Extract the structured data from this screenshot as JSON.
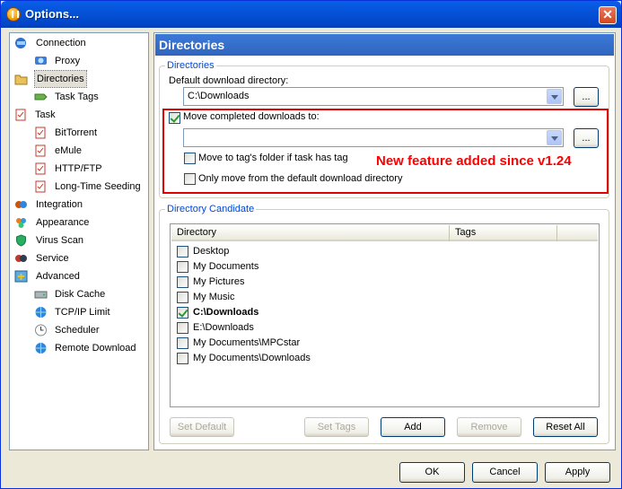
{
  "window": {
    "title": "Options...",
    "close_symbol": "✕"
  },
  "tree": {
    "items": [
      {
        "label": "Connection",
        "icon": "connection-icon"
      },
      {
        "label": "Proxy",
        "icon": "proxy-icon"
      },
      {
        "label": "Directories",
        "icon": "folder-open-icon",
        "selected": true
      },
      {
        "label": "Task Tags",
        "icon": "tag-icon"
      },
      {
        "label": "Task",
        "icon": "task-icon"
      },
      {
        "label": "BitTorrent",
        "icon": "task-icon"
      },
      {
        "label": "eMule",
        "icon": "task-icon"
      },
      {
        "label": "HTTP/FTP",
        "icon": "task-icon"
      },
      {
        "label": "Long-Time Seeding",
        "icon": "task-icon"
      },
      {
        "label": "Integration",
        "icon": "integration-icon"
      },
      {
        "label": "Appearance",
        "icon": "appearance-icon"
      },
      {
        "label": "Virus Scan",
        "icon": "shield-icon"
      },
      {
        "label": "Service",
        "icon": "service-icon"
      },
      {
        "label": "Advanced",
        "icon": "advanced-icon"
      },
      {
        "label": "Disk Cache",
        "icon": "disk-cache-icon"
      },
      {
        "label": "TCP/IP Limit",
        "icon": "globe-icon"
      },
      {
        "label": "Scheduler",
        "icon": "scheduler-icon"
      },
      {
        "label": "Remote Download",
        "icon": "globe-icon"
      }
    ]
  },
  "main": {
    "header": "Directories",
    "directories_group": {
      "title": "Directories",
      "default_dir_label": "Default download directory:",
      "default_dir_value": "C:\\Downloads",
      "browse_label": "...",
      "move_completed_label": "Move completed downloads to:",
      "move_completed_checked": true,
      "move_completed_value": "",
      "browse2_label": "...",
      "tag_folder_label": "Move to tag's folder if task has tag",
      "tag_folder_checked": false,
      "only_default_label": "Only move from the default download directory",
      "only_default_checked": false
    },
    "annotation": "New feature added since v1.24",
    "candidate_group": {
      "title": "Directory Candidate",
      "columns": [
        "Directory",
        "Tags"
      ],
      "rows": [
        {
          "dir": "Desktop",
          "checked": false
        },
        {
          "dir": "My Documents",
          "checked": false
        },
        {
          "dir": "My Pictures",
          "checked": false
        },
        {
          "dir": "My Music",
          "checked": false
        },
        {
          "dir": "C:\\Downloads",
          "checked": true
        },
        {
          "dir": "E:\\Downloads",
          "checked": false
        },
        {
          "dir": "My Documents\\MPCstar",
          "checked": false
        },
        {
          "dir": "My Documents\\Downloads",
          "checked": false
        }
      ],
      "buttons": {
        "set_default": "Set Default",
        "set_tags": "Set Tags",
        "add": "Add",
        "remove": "Remove",
        "reset_all": "Reset All"
      }
    }
  },
  "footer": {
    "ok": "OK",
    "cancel": "Cancel",
    "apply": "Apply"
  },
  "colors": {
    "title_bar": "#0553d8",
    "accent_blue": "#0046d5",
    "annotation_red": "#ff0000"
  }
}
